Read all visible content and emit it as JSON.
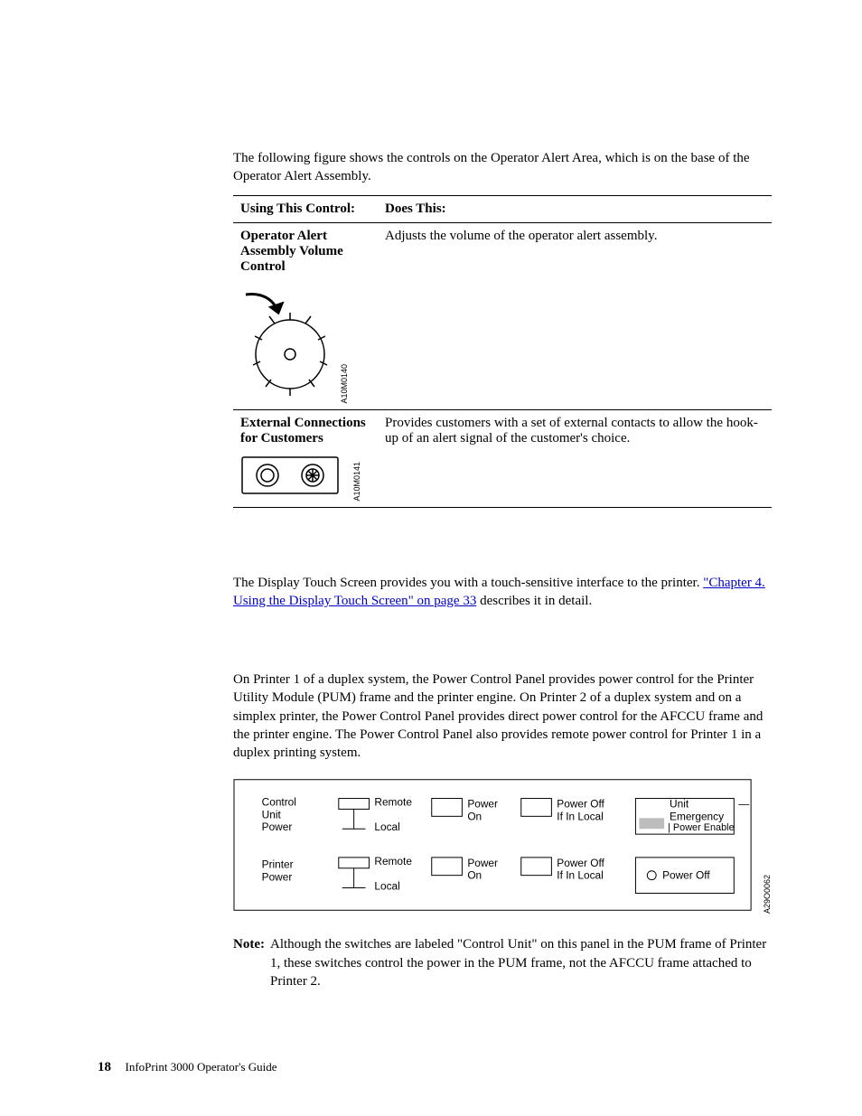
{
  "intro": "The following figure shows the controls on the Operator Alert Area, which is on the base of the Operator Alert Assembly.",
  "table": {
    "head_col1": "Using This Control:",
    "head_col2": "Does This:",
    "row1": {
      "name": "Operator Alert Assembly Volume Control",
      "desc": "Adjusts the volume of the operator alert assembly.",
      "figref": "A10M0140"
    },
    "row2": {
      "name": "External Connections for Customers",
      "desc": "Provides customers with a set of external contacts to allow the hook-up of an alert signal of the customer's choice.",
      "figref": "A10M0141"
    }
  },
  "para_touchscreen_pre": "The Display Touch Screen provides you with a touch-sensitive interface to the printer. ",
  "link_ch4": "\"Chapter 4. Using the Display Touch Screen\" on page 33",
  "para_touchscreen_post": " describes it in detail.",
  "para_power": "On Printer 1 of a duplex system, the Power Control Panel provides power control for the Printer Utility Module (PUM) frame and the printer engine. On Printer 2 of a duplex system and on a simplex printer, the Power Control Panel provides direct power control for the AFCCU frame and the printer engine. The Power Control Panel also provides remote power control for Printer 1 in a duplex printing system.",
  "panel": {
    "row1_label_l1": "Control",
    "row1_label_l2": "Unit",
    "row1_label_l3": "Power",
    "row2_label_l1": "Printer",
    "row2_label_l2": "Power",
    "toggle_remote": "Remote",
    "toggle_local": "Local",
    "btn_power_on": "Power",
    "btn_power_on_l2": "On",
    "btn_power_off": "Power Off",
    "btn_power_off_l2": "If In Local",
    "status_unit": "Unit",
    "status_emergency": "Emergency",
    "led_power_enable": "Power Enable",
    "led_power_off": "Power Off",
    "figref": "A29O0062"
  },
  "note_label": "Note:",
  "note_body": "Although the switches are labeled \"Control Unit\" on this panel in the PUM frame of Printer 1, these switches control the power in the PUM frame, not the AFCCU frame attached to Printer 2.",
  "footer_page": "18",
  "footer_title": "InfoPrint 3000 Operator's Guide"
}
